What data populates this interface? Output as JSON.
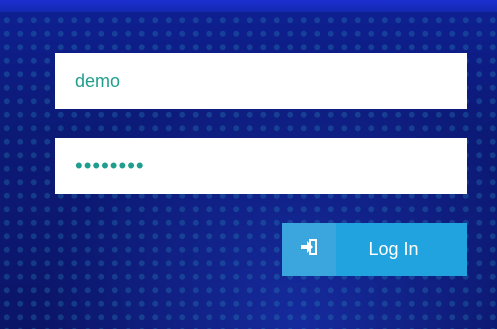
{
  "login_form": {
    "username_value": "demo",
    "password_value": "••••••••",
    "login_button_label": "Log In",
    "login_icon": "sign-in-icon"
  },
  "colors": {
    "background": "#0d1b6e",
    "input_background": "#ffffff",
    "input_text": "#1f9e8e",
    "button_primary": "#21a3df",
    "button_icon_bg": "#3aa6dd"
  }
}
